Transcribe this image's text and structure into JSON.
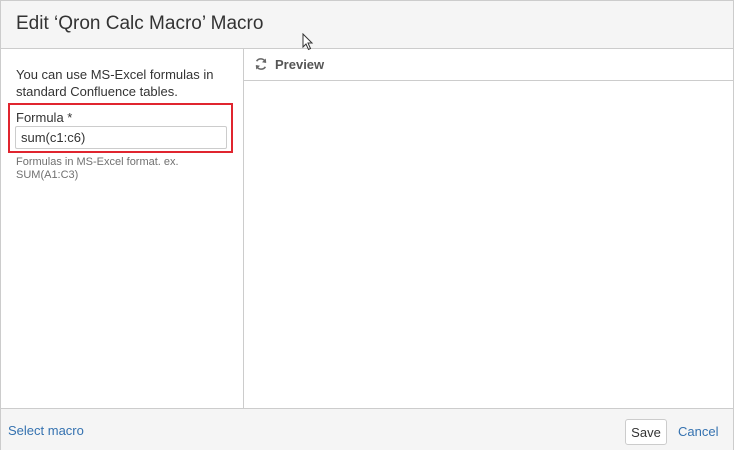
{
  "dialog": {
    "title": "Edit ‘Qron Calc Macro’ Macro"
  },
  "left_panel": {
    "intro": "You can use MS-Excel formulas in standard Confluence tables.",
    "formula": {
      "label": "Formula *",
      "value": "sum(c1:c6)",
      "help": "Formulas in MS-Excel format. ex. SUM(A1:C3)"
    }
  },
  "preview": {
    "icon": "refresh-icon",
    "label": "Preview"
  },
  "footer": {
    "select_macro": "Select macro",
    "save": "Save",
    "cancel": "Cancel"
  },
  "colors": {
    "accent_link": "#3572b0",
    "highlight_border": "#e0252f",
    "header_bg": "#f5f5f5"
  }
}
